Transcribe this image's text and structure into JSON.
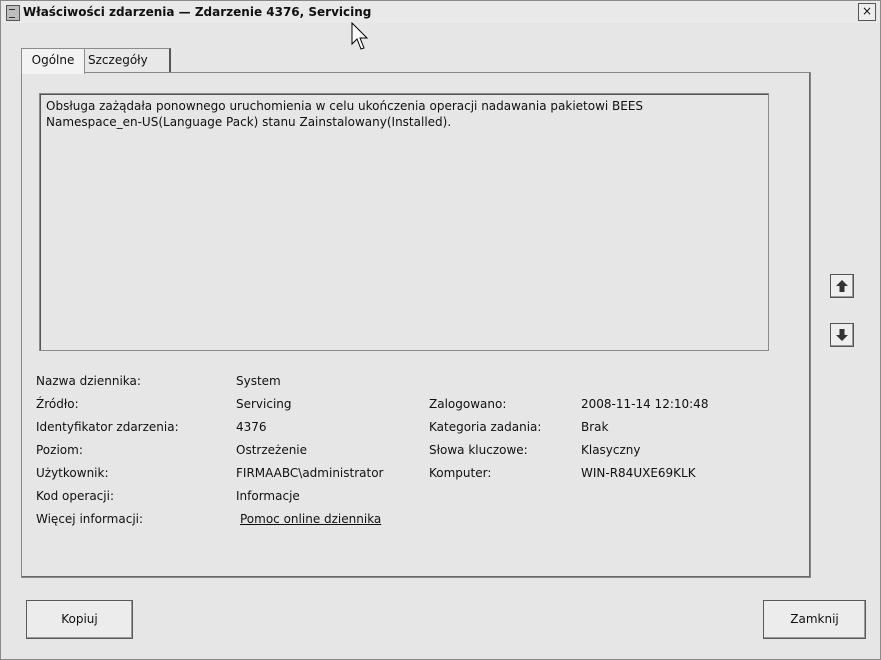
{
  "window": {
    "title": "Właściwości zdarzenia — Zdarzenie 4376, Servicing",
    "close_label": "×"
  },
  "tabs": [
    {
      "label": "Ogólne",
      "active": true
    },
    {
      "label": "Szczegóły",
      "active": false
    }
  ],
  "description": "Obsługa zażądała ponownego uruchomienia w celu ukończenia operacji nadawania pakietowi BEES\nNamespace_en-US(Language Pack) stanu Zainstalowany(Installed).",
  "properties_left": [
    {
      "label": "Nazwa dziennika:",
      "value": "System"
    },
    {
      "label": "Źródło:",
      "value": "Servicing"
    },
    {
      "label": "Identyfikator zdarzenia:",
      "value": "4376"
    },
    {
      "label": "Poziom:",
      "value": "Ostrzeżenie"
    },
    {
      "label": "Użytkownik:",
      "value": "FIRMAABC\\administrator"
    },
    {
      "label": "Kod operacji:",
      "value": "Informacje"
    },
    {
      "label": "Więcej informacji:",
      "value": "Pomoc online dziennika"
    }
  ],
  "properties_right": [
    {
      "label": "Zalogowano:",
      "value": "2008-11-14 12:10:48"
    },
    {
      "label": "Kategoria zadania:",
      "value": "Brak"
    },
    {
      "label": "Słowa kluczowe:",
      "value": "Klasyczny"
    },
    {
      "label": "Komputer:",
      "value": "WIN-R84UXE69KLK"
    }
  ],
  "icons": {
    "prev": "arrow-up-icon",
    "next": "arrow-down-icon"
  },
  "buttons": {
    "copy": "Kopiuj",
    "close": "Zamknij"
  }
}
